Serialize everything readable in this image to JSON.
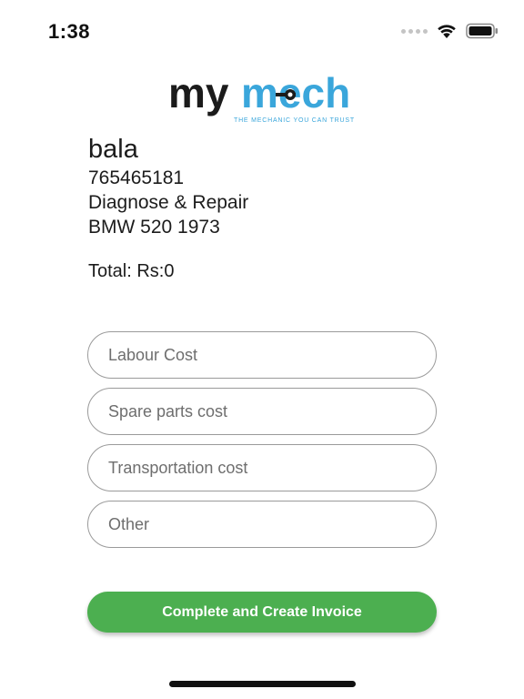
{
  "status_bar": {
    "time": "1:38"
  },
  "logo": {
    "brand_part1": "my",
    "brand_part2": "mech",
    "tagline": "THE MECHANIC YOU CAN TRUST",
    "colors": {
      "dark": "#1b1b1b",
      "accent": "#3aa6db"
    }
  },
  "customer": {
    "name": "bala",
    "phone": "765465181",
    "service": "Diagnose & Repair",
    "vehicle": "BMW 520 1973"
  },
  "total": {
    "text": "Total: Rs:0"
  },
  "form": {
    "labour_placeholder": "Labour Cost",
    "spare_parts_placeholder": "Spare parts cost",
    "transportation_placeholder": "Transportation cost",
    "other_placeholder": "Other"
  },
  "actions": {
    "create_invoice_label": "Complete and Create Invoice"
  },
  "colors": {
    "primary_button": "#4caf50",
    "field_border": "#9a9a9a"
  }
}
